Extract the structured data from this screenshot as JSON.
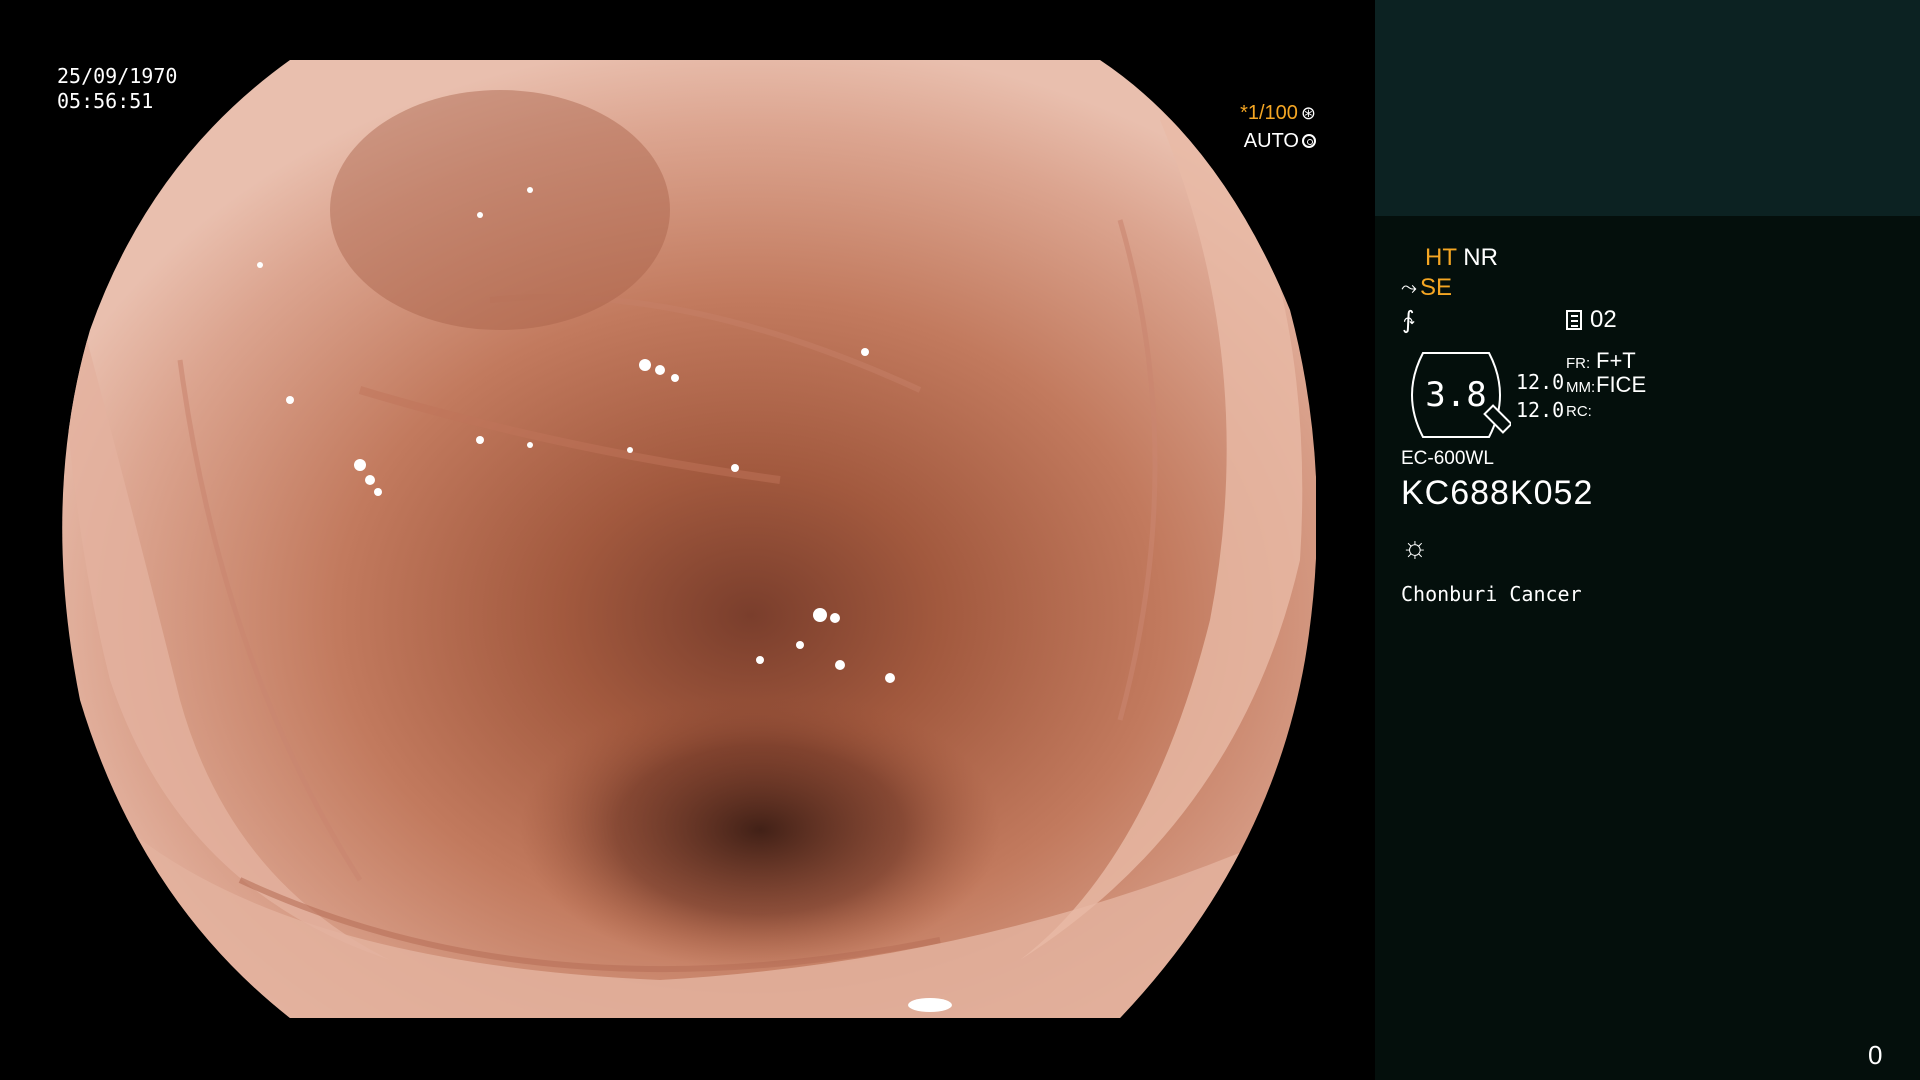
{
  "overlay": {
    "date": "25/09/1970",
    "time": "05:56:51",
    "shutter_speed": "*1/100",
    "exposure_mode": "AUTO"
  },
  "panel": {
    "ht": "HT",
    "nr": "NR",
    "se": "SE",
    "mode_number": "02",
    "zoom": "3.8",
    "values": [
      "12.0",
      "12.0"
    ],
    "labels": [
      "FR:",
      "MM:",
      "RC:"
    ],
    "label_values": [
      "F+T",
      "FICE",
      ""
    ],
    "scope_model": "EC-600WL",
    "scope_serial": "KC688K052",
    "hospital": "Chonburi Cancer"
  },
  "footer": {
    "counter": "0"
  },
  "colors": {
    "accent": "#f5a623",
    "panel_top": "#0c2222",
    "panel": "#040f0c"
  },
  "icons": [
    "shutter-icon",
    "iris-icon",
    "scope-angle-icon",
    "tone-curve-icon",
    "memory-icon",
    "zoom-indicator-icon",
    "light-source-icon"
  ]
}
